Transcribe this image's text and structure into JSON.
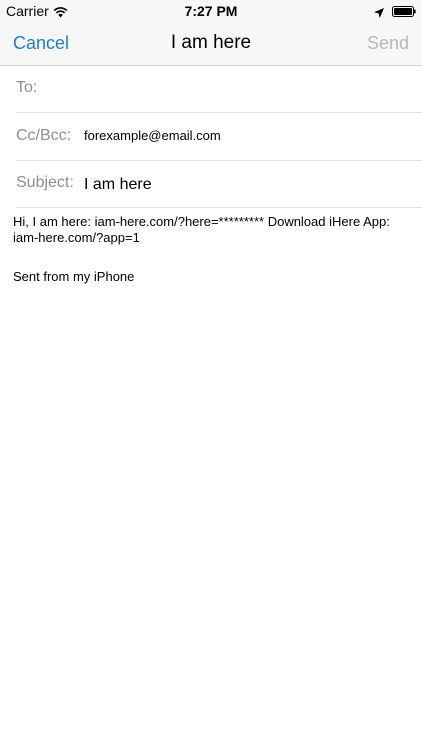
{
  "status_bar": {
    "carrier": "Carrier",
    "time": "7:27 PM",
    "icons": [
      "wifi-icon",
      "location-icon",
      "battery-icon"
    ]
  },
  "nav": {
    "cancel_label": "Cancel",
    "title": "I am here",
    "send_label": "Send"
  },
  "fields": {
    "to_label": "To:",
    "to_value": "",
    "cc_label": "Cc/Bcc:",
    "cc_value": "forexample@email.com",
    "subject_label": "Subject:",
    "subject_value": "I am here"
  },
  "message": {
    "body": "Hi, I am here: iam-here.com/?here=********* Download iHere App: iam-here.com/?app=1",
    "signature": "Sent from my iPhone"
  },
  "colors": {
    "accent": "#1f7dd3",
    "disabled": "#b8b8bd",
    "label_gray": "#8e8e93",
    "bar_background": "#f7f7f7"
  }
}
